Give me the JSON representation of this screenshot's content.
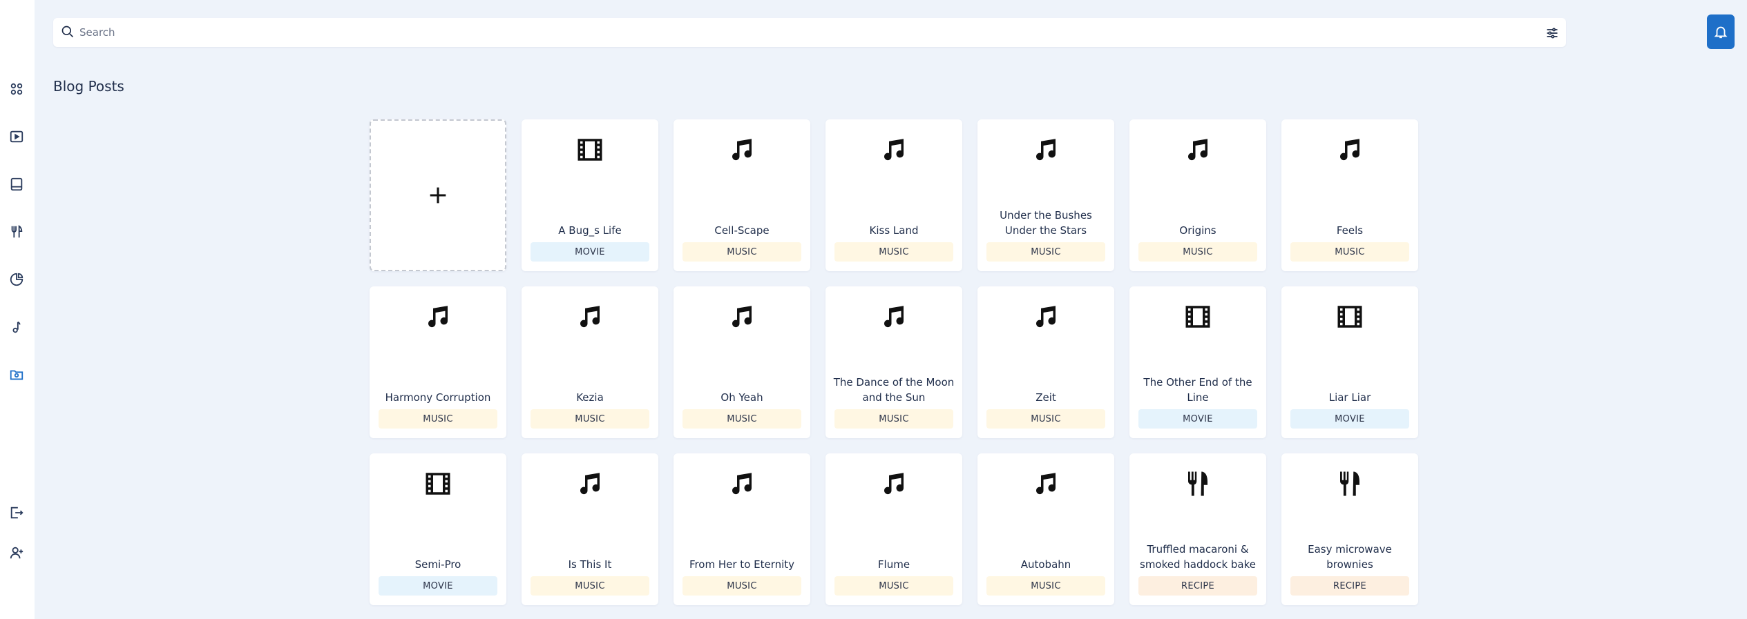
{
  "search": {
    "placeholder": "Search"
  },
  "page": {
    "title": "Blog Posts"
  },
  "colors": {
    "accent": "#1e6fc8",
    "badge_music": "#fff7e3",
    "badge_movie": "#e5f3fc",
    "badge_recipe": "#fdefe0"
  },
  "sidebar": {
    "items": [
      {
        "icon": "grid-icon"
      },
      {
        "icon": "video-icon"
      },
      {
        "icon": "book-icon"
      },
      {
        "icon": "utensils-icon"
      },
      {
        "icon": "pie-chart-icon"
      },
      {
        "icon": "music-note-icon"
      },
      {
        "icon": "folder-icon",
        "active": true
      },
      {
        "icon": "logout-icon"
      },
      {
        "icon": "user-plus-icon"
      }
    ]
  },
  "posts": [
    {
      "title": "A Bug_s Life",
      "category": "MOVIE",
      "icon": "film-icon"
    },
    {
      "title": "Cell-Scape",
      "category": "MUSIC",
      "icon": "music-icon"
    },
    {
      "title": "Kiss Land",
      "category": "MUSIC",
      "icon": "music-icon"
    },
    {
      "title": "Under the Bushes Under the Stars",
      "category": "MUSIC",
      "icon": "music-icon"
    },
    {
      "title": "Origins",
      "category": "MUSIC",
      "icon": "music-icon"
    },
    {
      "title": "Feels",
      "category": "MUSIC",
      "icon": "music-icon"
    },
    {
      "title": "Harmony Corruption",
      "category": "MUSIC",
      "icon": "music-icon"
    },
    {
      "title": "Kezia",
      "category": "MUSIC",
      "icon": "music-icon"
    },
    {
      "title": "Oh Yeah",
      "category": "MUSIC",
      "icon": "music-icon"
    },
    {
      "title": "The Dance of the Moon and the Sun",
      "category": "MUSIC",
      "icon": "music-icon"
    },
    {
      "title": "Zeit",
      "category": "MUSIC",
      "icon": "music-icon"
    },
    {
      "title": "The Other End of the Line",
      "category": "MOVIE",
      "icon": "film-icon"
    },
    {
      "title": "Liar Liar",
      "category": "MOVIE",
      "icon": "film-icon"
    },
    {
      "title": "Semi-Pro",
      "category": "MOVIE",
      "icon": "film-icon"
    },
    {
      "title": "Is This It",
      "category": "MUSIC",
      "icon": "music-icon"
    },
    {
      "title": "From Her to Eternity",
      "category": "MUSIC",
      "icon": "music-icon"
    },
    {
      "title": "Flume",
      "category": "MUSIC",
      "icon": "music-icon"
    },
    {
      "title": "Autobahn",
      "category": "MUSIC",
      "icon": "music-icon"
    },
    {
      "title": "Truffled macaroni & smoked haddock bake",
      "category": "RECIPE",
      "icon": "utensils-icon"
    },
    {
      "title": "Easy microwave brownies",
      "category": "RECIPE",
      "icon": "utensils-icon"
    }
  ]
}
